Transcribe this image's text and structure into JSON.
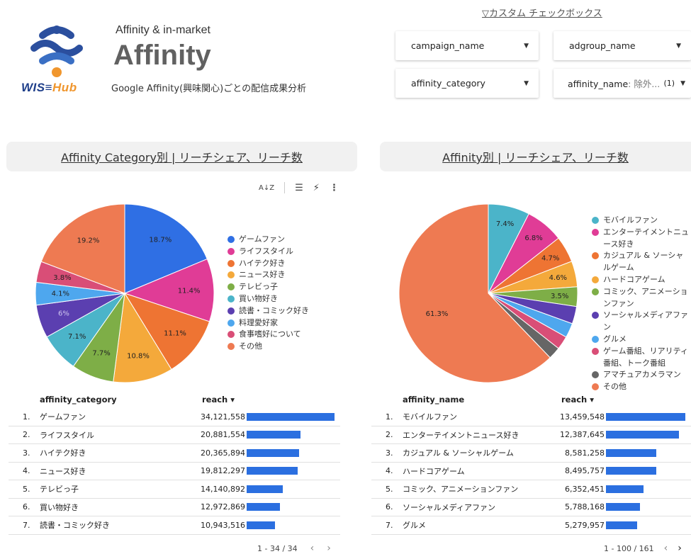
{
  "header": {
    "logo_text_1": "WIS≡",
    "logo_text_2": "Hub",
    "subtitle": "Affinity & in-market",
    "title": "Affinity",
    "description": "Google Affinity(興味関心)ごとの配信成果分析"
  },
  "custom_link": "▽カスタム チェックボックス",
  "filters": [
    {
      "label": "campaign_name"
    },
    {
      "label": "adgroup_name"
    },
    {
      "label": "affinity_category"
    },
    {
      "label": "affinity_name",
      "value": ": 除外...",
      "count": "(1)"
    }
  ],
  "left_panel": {
    "title": "Affinity Category別 | リーチシェア、リーチ数",
    "toolbar": {
      "sort_icon": "A↓Z",
      "filter_icon": "☰",
      "bolt_icon": "⚡",
      "more_icon": "⋮"
    },
    "legend": [
      "ゲームファン",
      "ライフスタイル",
      "ハイテク好き",
      "ニュース好き",
      "テレビっ子",
      "買い物好き",
      "読書・コミック好き",
      "料理愛好家",
      "食事嗜好について",
      "その他"
    ],
    "pie_labels": [
      "18.7%",
      "11.4%",
      "11.1%",
      "10.8%",
      "7.7%",
      "7.1%",
      "6%",
      "4.1%",
      "3.8%",
      "19.2%"
    ],
    "table": {
      "col1": "affinity_category",
      "col2": "reach ▾",
      "rows": [
        {
          "idx": "1.",
          "name": "ゲームファン",
          "value": "34,121,558"
        },
        {
          "idx": "2.",
          "name": "ライフスタイル",
          "value": "20,881,554"
        },
        {
          "idx": "3.",
          "name": "ハイテク好き",
          "value": "20,365,894"
        },
        {
          "idx": "4.",
          "name": "ニュース好き",
          "value": "19,812,297"
        },
        {
          "idx": "5.",
          "name": "テレビっ子",
          "value": "14,140,892"
        },
        {
          "idx": "6.",
          "name": "買い物好き",
          "value": "12,972,869"
        },
        {
          "idx": "7.",
          "name": "読書・コミック好き",
          "value": "10,943,516"
        }
      ],
      "pager": "1 - 34 / 34"
    }
  },
  "right_panel": {
    "title": "Affinity別 | リーチシェア、リーチ数",
    "legend": [
      "モバイルファン",
      "エンターテイメントニュース好き",
      "カジュアル & ソーシャルゲーム",
      "ハードコアゲーム",
      "コミック、アニメーションファン",
      "ソーシャルメディアファン",
      "グルメ",
      "ゲーム番組、リアリティ番組、トーク番組",
      "アマチュアカメラマン",
      "その他"
    ],
    "pie_labels": [
      "7.4%",
      "6.8%",
      "4.7%",
      "4.6%",
      "3.5%",
      "61.3%"
    ],
    "table": {
      "col1": "affinity_name",
      "col2": "reach ▾",
      "rows": [
        {
          "idx": "1.",
          "name": "モバイルファン",
          "value": "13,459,548"
        },
        {
          "idx": "2.",
          "name": "エンターテイメントニュース好き",
          "value": "12,387,645"
        },
        {
          "idx": "3.",
          "name": "カジュアル & ソーシャルゲーム",
          "value": "8,581,258"
        },
        {
          "idx": "4.",
          "name": "ハードコアゲーム",
          "value": "8,495,757"
        },
        {
          "idx": "5.",
          "name": "コミック、アニメーションファン",
          "value": "6,352,451"
        },
        {
          "idx": "6.",
          "name": "ソーシャルメディアファン",
          "value": "5,788,168"
        },
        {
          "idx": "7.",
          "name": "グルメ",
          "value": "5,279,957"
        }
      ],
      "pager": "1 - 100 / 161"
    }
  },
  "chart_data": [
    {
      "type": "pie",
      "categories": [
        "ゲームファン",
        "ライフスタイル",
        "ハイテク好き",
        "ニュース好き",
        "テレビっ子",
        "買い物好き",
        "読書・コミック好き",
        "料理愛好家",
        "食事嗜好について",
        "その他"
      ],
      "values": [
        18.7,
        11.4,
        11.1,
        10.8,
        7.7,
        7.1,
        6.0,
        4.1,
        3.8,
        19.2
      ],
      "colors": [
        "#2f6fe4",
        "#e03c96",
        "#ee7433",
        "#f4a93b",
        "#7eae47",
        "#4bb4c9",
        "#5b3fb0",
        "#4ea7ee",
        "#d94e77",
        "#ee7a52"
      ]
    },
    {
      "type": "pie",
      "categories": [
        "モバイルファン",
        "エンターテイメントニュース好き",
        "カジュアル & ソーシャルゲーム",
        "ハードコアゲーム",
        "コミック、アニメーションファン",
        "ソーシャルメディアファン",
        "グルメ",
        "ゲーム番組、リアリティ番組、トーク番組",
        "アマチュアカメラマン",
        "その他"
      ],
      "values": [
        7.4,
        6.8,
        4.7,
        4.6,
        3.5,
        3.1,
        2.6,
        2.4,
        2.2,
        61.3
      ],
      "colors": [
        "#4bb4c9",
        "#e03c96",
        "#ee7433",
        "#f4a93b",
        "#7eae47",
        "#5b3fb0",
        "#4ea7ee",
        "#d94e77",
        "#666666",
        "#ee7a52"
      ]
    },
    {
      "type": "bar",
      "categories": [
        "ゲームファン",
        "ライフスタイル",
        "ハイテク好き",
        "ニュース好き",
        "テレビっ子",
        "買い物好き",
        "読書・コミック好き"
      ],
      "values": [
        34121558,
        20881554,
        20365894,
        19812297,
        14140892,
        12972869,
        10943516
      ]
    },
    {
      "type": "bar",
      "categories": [
        "モバイルファン",
        "エンターテイメントニュース好き",
        "カジュアル & ソーシャルゲーム",
        "ハードコアゲーム",
        "コミック、アニメーションファン",
        "ソーシャルメディアファン",
        "グルメ"
      ],
      "values": [
        13459548,
        12387645,
        8581258,
        8495757,
        6352451,
        5788168,
        5279957
      ]
    }
  ]
}
